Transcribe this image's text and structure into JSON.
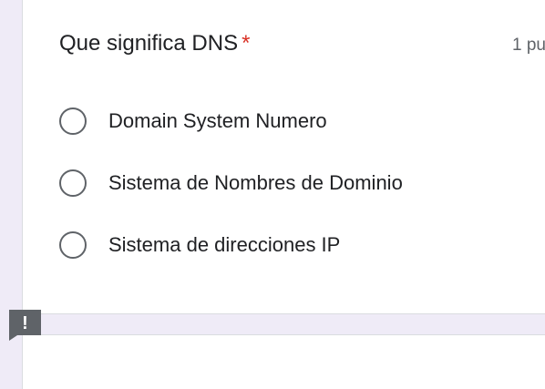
{
  "question": {
    "title": "Que significa DNS",
    "required_marker": "*",
    "points": "1 pu"
  },
  "options": [
    {
      "label": "Domain System Numero"
    },
    {
      "label": "Sistema de Nombres de Dominio"
    },
    {
      "label": "Sistema de direcciones IP"
    }
  ],
  "alert": {
    "icon": "alert-flag-icon",
    "glyph": "!"
  },
  "colors": {
    "background": "#efebf7",
    "card": "#ffffff",
    "required": "#d93025",
    "radio_border": "#5f6368",
    "text": "#202124",
    "alert_badge": "#5f6368"
  }
}
